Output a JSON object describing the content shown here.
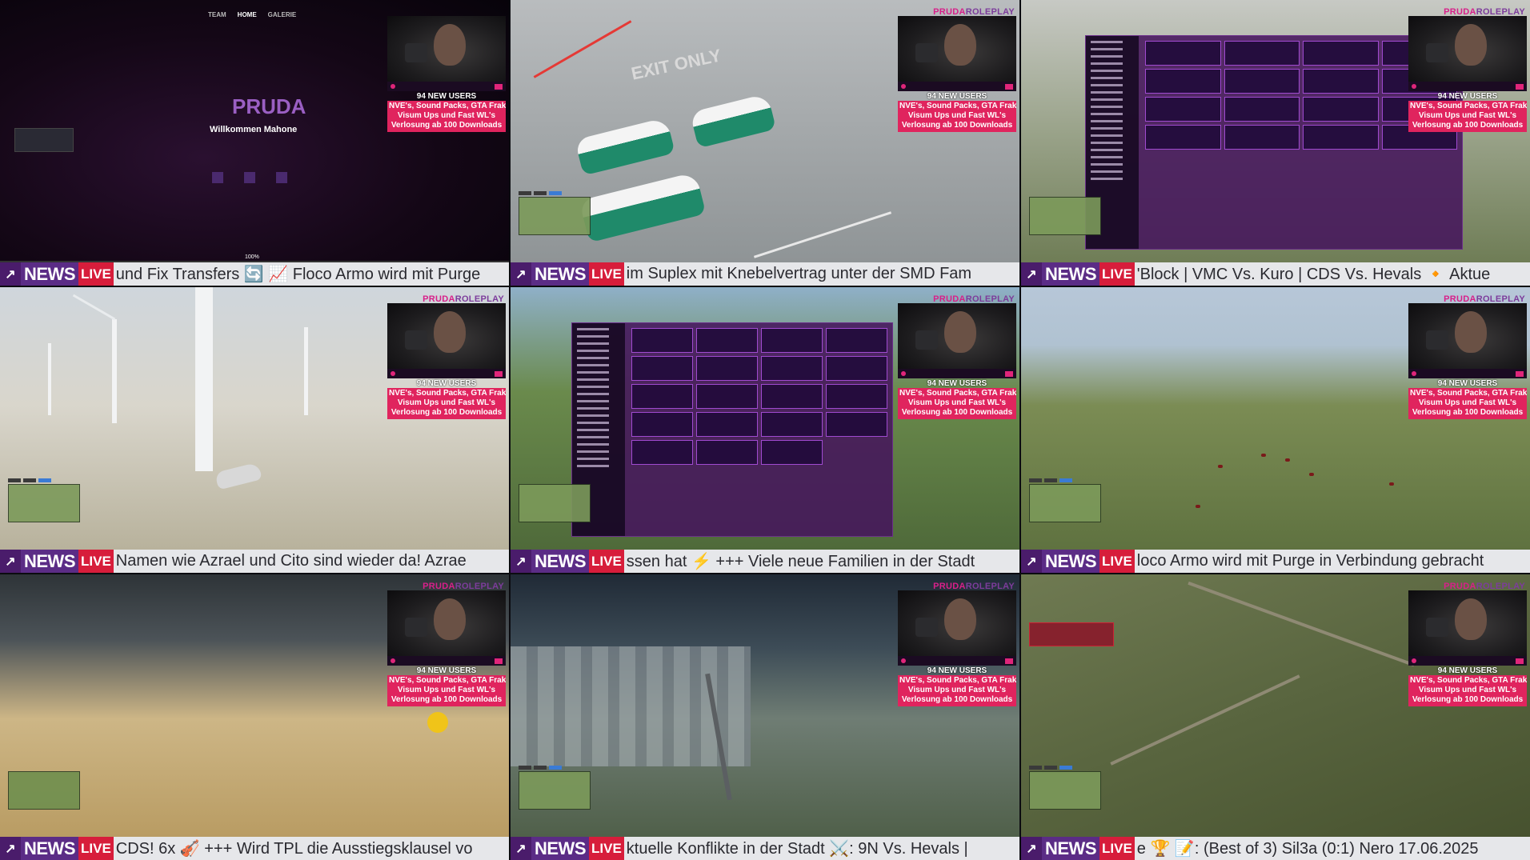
{
  "overlay": {
    "brand_primary": "PRUDA",
    "brand_secondary": "ROLEPLAY",
    "new_users": "94 NEW USERS",
    "promo_lines": [
      "NVE's, Sound Packs, GTA Frak Kleidu",
      "Visum Ups und Fast WL's",
      "Verlosung ab 100 Downloads"
    ],
    "colors": {
      "pink": "#e0245e",
      "purple": "#5b2c86",
      "live_red": "#d71d3b"
    }
  },
  "ticker": {
    "news_label": "NEWS",
    "live_label": "LIVE"
  },
  "website": {
    "nav": [
      "TEAM",
      "HOME",
      "GALERIE"
    ],
    "logo": "PRUDA",
    "welcome": "Willkommen Mahone",
    "progress": "100%"
  },
  "tiles": [
    {
      "ticker_text": "und Fix Transfers 🔄 📈 Floco Armo wird mit Purge"
    },
    {
      "ticker_text": "im Suplex mit Knebelvertrag unter der SMD Fam"
    },
    {
      "ticker_text": "'Block | VMC Vs. Kuro | CDS Vs. Hevals 🔸 Aktue"
    },
    {
      "ticker_text": "Namen wie Azrael und Cito sind wieder da! Azrae"
    },
    {
      "ticker_text": "ssen hat ⚡ +++ Viele neue Familien in der Stadt"
    },
    {
      "ticker_text": "loco Armo wird mit Purge in Verbindung gebracht"
    },
    {
      "ticker_text": "CDS! 6x 🎻 +++ Wird TPL die Ausstiegsklausel vo"
    },
    {
      "ticker_text": "ktuelle Konflikte in der Stadt ⚔️: 9N Vs. Hevals |"
    },
    {
      "ticker_text": "e 🏆 📝: (Best of 3) Sil3a (0:1) Nero 17.06.2025"
    }
  ],
  "scene_road": {
    "ground_text": "EXIT ONLY"
  }
}
